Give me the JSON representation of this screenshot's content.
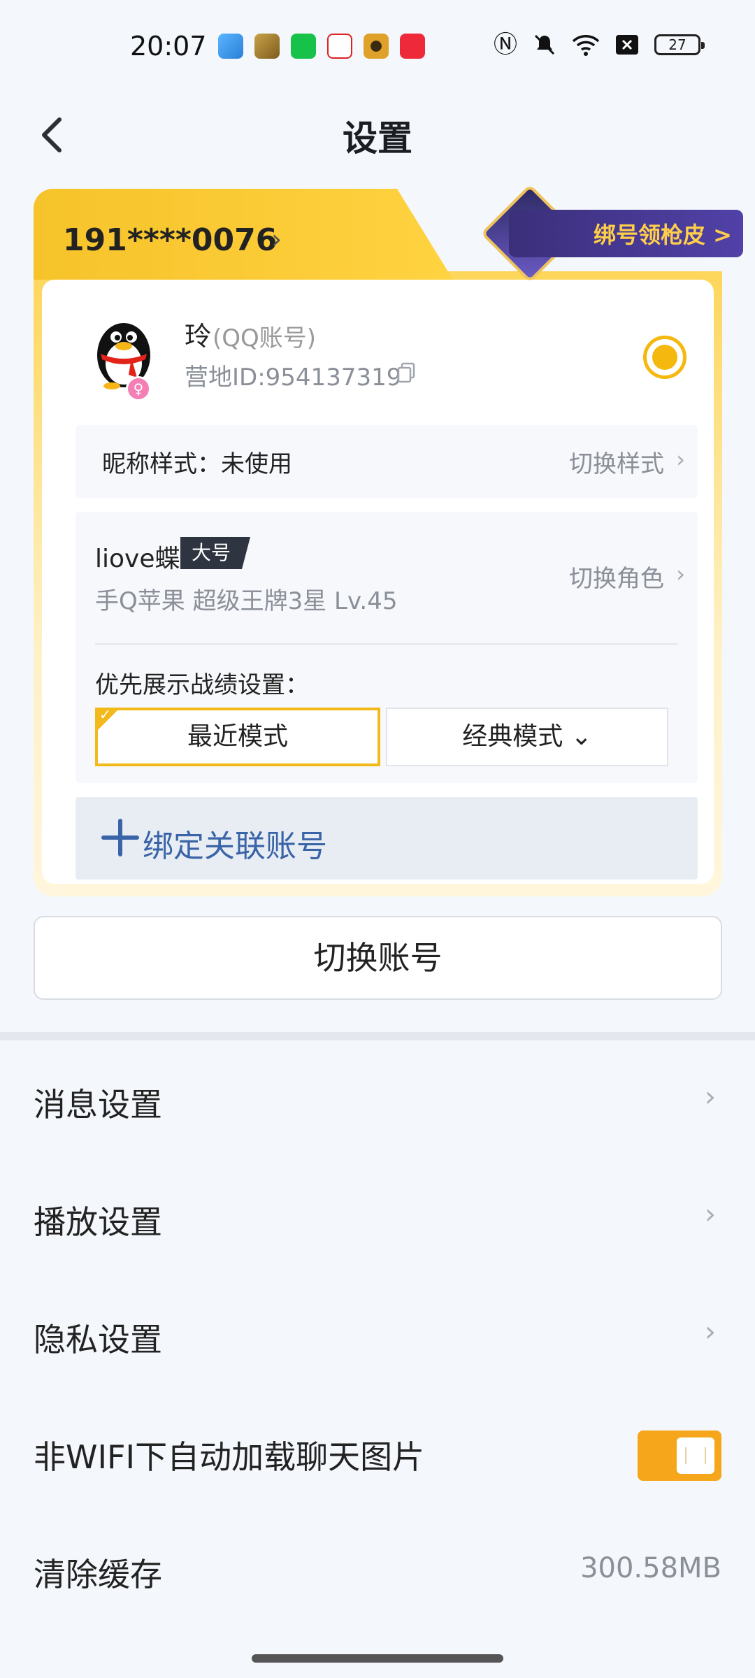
{
  "status_bar": {
    "time": "20:07",
    "battery": "27",
    "icons": [
      "gallery-app-icon",
      "game-app-icon",
      "store-app-icon",
      "news-app-icon",
      "music-app-icon",
      "music-red-app-icon",
      "nfc-icon",
      "mute-icon",
      "wifi-icon",
      "close-box-icon"
    ]
  },
  "header": {
    "title": "设置"
  },
  "account_card": {
    "phone": "191****0076",
    "promo_label": "绑号领枪皮 >",
    "user_name": "玲",
    "user_type": "(QQ账号)",
    "camp_id": "营地ID:954137319",
    "nickname_style": "昵称样式：未使用",
    "nickname_switch": "切换样式",
    "role_name": "liove蝶",
    "role_tag": "大号",
    "role_info": "手Q苹果  超级王牌3星  Lv.45",
    "role_switch": "切换角色",
    "stats_label": "优先展示战绩设置：",
    "mode_recent": "最近模式",
    "mode_classic": "经典模式 ⌄",
    "bind_label": "绑定关联账号"
  },
  "switch_account": "切换账号",
  "menu": {
    "message": "消息设置",
    "playback": "播放设置",
    "privacy": "隐私设置",
    "auto_load": "非WIFI下自动加载聊天图片",
    "auto_load_on": true,
    "clear_cache": "清除缓存",
    "cache_size": "300.58MB"
  },
  "colors": {
    "accent": "#f5b80e",
    "link": "#3a64a8",
    "bg": "#f4f7fb"
  }
}
